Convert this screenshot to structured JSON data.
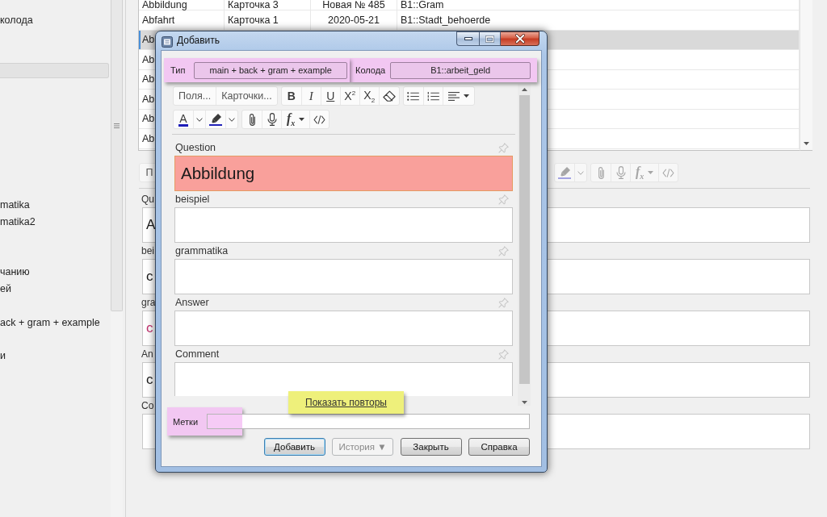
{
  "sidebar": {
    "items": [
      {
        "label": "колода",
        "selected": false
      },
      {
        "selected": true
      },
      {
        "label": "matika",
        "selected": false
      },
      {
        "label": "matika2",
        "selected": false
      },
      {
        "label": "чанию",
        "selected": false
      },
      {
        "label": "ей",
        "selected": false
      },
      {
        "label": "ack + gram + example",
        "selected": false
      },
      {
        "label": "и",
        "selected": false
      }
    ]
  },
  "table": {
    "rows": [
      {
        "cells": [
          "Abbildung",
          "Карточка 3",
          "Новая № 485",
          "B1::Gram"
        ],
        "selected": false
      },
      {
        "cells": [
          "Abfahrt",
          "Карточка 1",
          "2020-05-21",
          "B1::Stadt_behoerde"
        ],
        "selected": false
      },
      {
        "cells": [
          "Ab"
        ],
        "selected": true
      },
      {
        "cells": [
          "Ab"
        ],
        "selected": false
      },
      {
        "cells": [
          "Ab"
        ],
        "selected": false
      },
      {
        "cells": [
          "Ab"
        ],
        "selected": false
      },
      {
        "cells": [
          "Ab"
        ],
        "selected": false
      },
      {
        "cells": [
          "Ab"
        ],
        "selected": false
      }
    ]
  },
  "editor": {
    "toolbar": [
      [
        {
          "kind": "text",
          "label": "П"
        }
      ],
      [
        {
          "kind": "highlight",
          "dropdown": true
        }
      ],
      [
        {
          "kind": "attach"
        },
        {
          "kind": "record"
        },
        {
          "kind": "formula",
          "label": "f$_{x}$",
          "dropdown": true
        },
        {
          "kind": "html"
        }
      ]
    ],
    "fields": [
      {
        "label": "Qu",
        "value": "A",
        "color": "#1a1a1a"
      },
      {
        "label": "bei",
        "value": "c",
        "color": "#1a1a1a"
      },
      {
        "label": "gra",
        "value": "c",
        "color": "#c2306e"
      },
      {
        "label": "An",
        "value": "c",
        "color": "#1a1a1a"
      },
      {
        "label": "Co"
      }
    ]
  },
  "dialog": {
    "title": "Добавить",
    "note_type": {
      "label": "Тип",
      "value": "main + back + gram + example",
      "highlighted": true
    },
    "deck": {
      "label": "Колода",
      "value": "B1::arbeit_geld",
      "highlighted": true
    },
    "toolbar": {
      "rows": [
        [
          [
            {
              "kind": "text",
              "label": "Поля..."
            },
            {
              "kind": "text",
              "label": "Карточки..."
            }
          ],
          [
            {
              "kind": "bold",
              "label": "B"
            },
            {
              "kind": "italic",
              "label": "I"
            },
            {
              "kind": "underline",
              "label": "U"
            },
            {
              "kind": "superscript",
              "label": "X$^{2}$"
            },
            {
              "kind": "subscript",
              "label": "X$_{2}$"
            },
            {
              "kind": "eraser"
            }
          ],
          [
            {
              "kind": "bullets"
            },
            {
              "kind": "numbers"
            },
            {
              "kind": "align",
              "dropdown": true
            }
          ]
        ],
        [
          [
            {
              "kind": "textcolor",
              "label": "A",
              "dropdown": true
            },
            {
              "kind": "highlight",
              "dropdown": true
            }
          ],
          [
            {
              "kind": "attach"
            },
            {
              "kind": "record"
            },
            {
              "kind": "formula",
              "label": "f$_{x}$",
              "dropdown": true
            },
            {
              "kind": "html"
            }
          ]
        ]
      ]
    },
    "fields": [
      {
        "label": "Question",
        "value": "Abbildung",
        "duplicate": true,
        "sticky": false
      },
      {
        "label": "beispiel",
        "duplicate": false,
        "sticky": false
      },
      {
        "label": "grammatika",
        "duplicate": false,
        "sticky": false
      },
      {
        "label": "Answer",
        "duplicate": false,
        "sticky": false
      },
      {
        "label": "Comment",
        "duplicate": false,
        "sticky": false
      }
    ],
    "duplicates_link": {
      "label": "Показать повторы",
      "highlighted": true
    },
    "tags": {
      "label": "Метки",
      "highlighted": true
    },
    "buttons": [
      {
        "label": "Добавить",
        "default": true,
        "disabled": false
      },
      {
        "label": "История ▼",
        "default": false,
        "disabled": true
      },
      {
        "label": "Закрыть",
        "default": false,
        "disabled": false
      },
      {
        "label": "Справка",
        "default": false,
        "disabled": false
      }
    ]
  }
}
